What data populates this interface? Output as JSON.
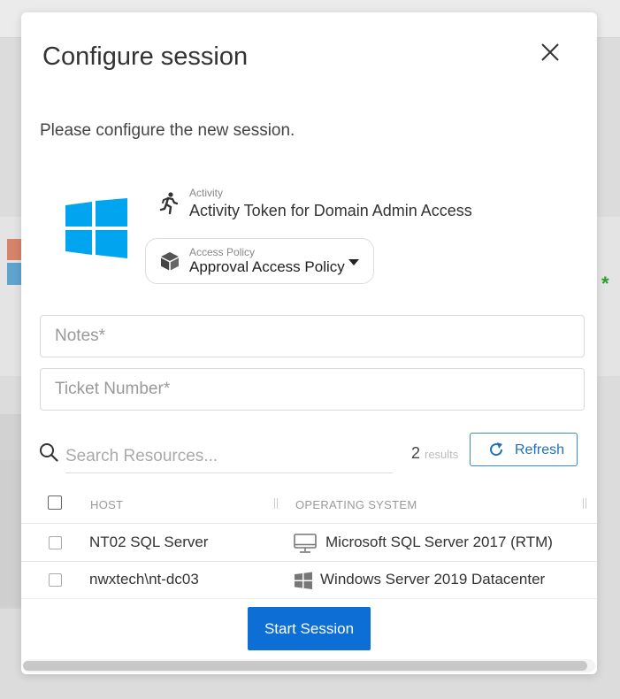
{
  "modal": {
    "title": "Configure session",
    "intro": "Please configure the new session.",
    "activity": {
      "label": "Activity",
      "value": "Activity Token for Domain Admin Access"
    },
    "access_policy": {
      "label": "Access Policy",
      "value": "Approval Access Policy"
    },
    "notes_placeholder": "Notes*",
    "ticket_placeholder": "Ticket Number*",
    "search": {
      "placeholder": "Search Resources..."
    },
    "results_count": "2",
    "results_label": "results",
    "refresh_label": "Refresh",
    "table": {
      "columns": [
        "HOST",
        "OPERATING SYSTEM"
      ],
      "rows": [
        {
          "host": "NT02 SQL Server",
          "os": "Microsoft SQL Server 2017 (RTM)",
          "os_icon": "monitor-icon"
        },
        {
          "host": "nwxtech\\nt-dc03",
          "os": "Windows Server 2019 Datacenter",
          "os_icon": "windows-icon"
        }
      ]
    },
    "start_label": "Start Session"
  },
  "colors": {
    "primary": "#0d6fd6",
    "windows_blue": "#00a4ef",
    "refresh_border": "#3b8ad0"
  }
}
